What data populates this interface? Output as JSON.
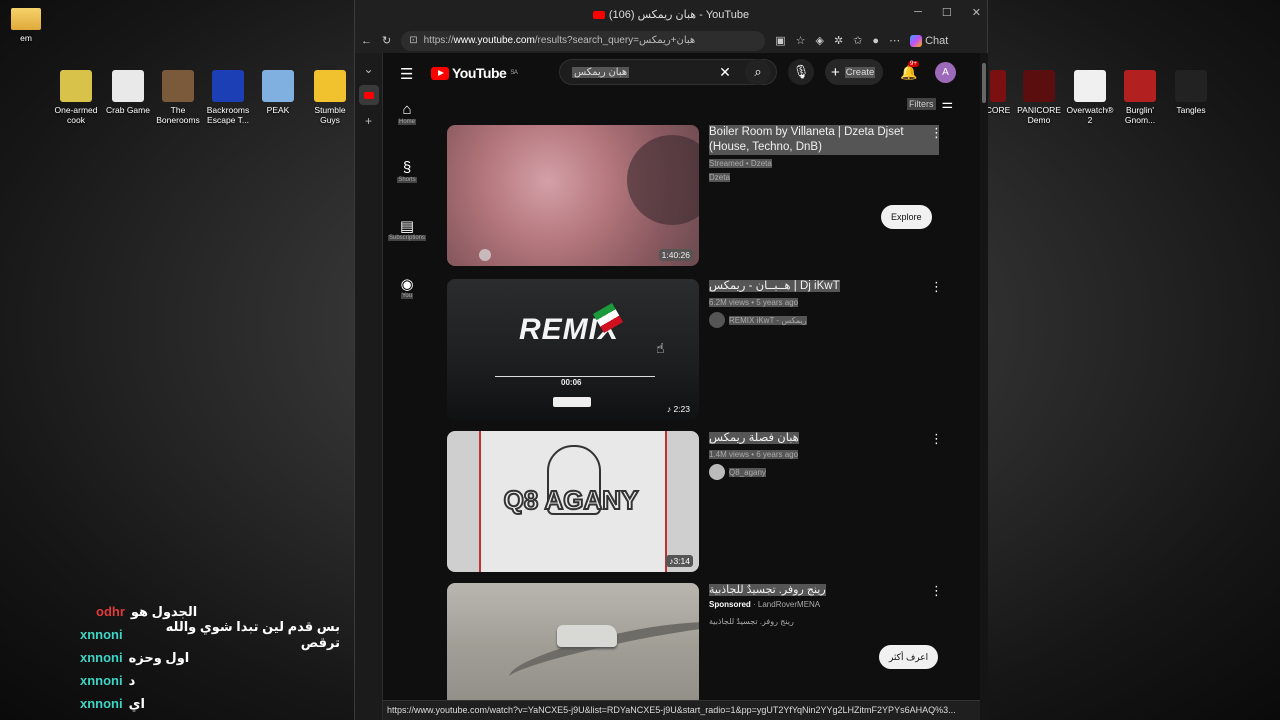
{
  "desktop": {
    "folder_label": "em",
    "icons_left": [
      {
        "label": "One-armed cook",
        "color": "#d9c24a"
      },
      {
        "label": "Crab Game",
        "color": "#e9e9e9"
      },
      {
        "label": "The Bonerooms",
        "color": "#7a5a3a"
      },
      {
        "label": "Backrooms Escape T...",
        "color": "#1d3fb5"
      },
      {
        "label": "PEAK",
        "color": "#7fb0e0"
      },
      {
        "label": "Stumble Guys",
        "color": "#f2c12e"
      }
    ],
    "icons_right": [
      {
        "label": "CORE",
        "color": "#7a1010"
      },
      {
        "label": "PANICORE Demo",
        "color": "#5a0e0e"
      },
      {
        "label": "Overwatch® 2",
        "color": "#f0f0f0"
      },
      {
        "label": "Burglin' Gnom...",
        "color": "#b32020"
      },
      {
        "label": "Tangles",
        "color": "#222222"
      }
    ]
  },
  "chat": [
    {
      "user": "odhr",
      "msg": "الجدول هو",
      "alt": true
    },
    {
      "user": "xnnoni",
      "msg": "بس قدم لين تبدا شوي والله ترقص",
      "alt": false
    },
    {
      "user": "xnnoni",
      "msg": "اول وحزه",
      "alt": false
    },
    {
      "user": "xnnoni",
      "msg": "د",
      "alt": false
    },
    {
      "user": "xnnoni",
      "msg": "اي",
      "alt": false
    }
  ],
  "browser": {
    "tab_title": "(106) هبان ريمكس - YouTube",
    "url_prefix": "https://",
    "url_domain": "www.youtube.com",
    "url_rest": "/results?search_query=هبان+ريمكس",
    "chat_label": "Chat",
    "status_url": "https://www.youtube.com/watch?v=YaNCXE5-j9U&list=RDYaNCXE5-j9U&start_radio=1&pp=ygUT2YfYqNin2YYg2LHZitmF2YPYs6AHAQ%3..."
  },
  "youtube": {
    "logo_text": "YouTube",
    "logo_region": "SA",
    "search_value": "هبان ريمكس",
    "create_label": "Create",
    "notif_count": "9+",
    "avatar_letter": "A",
    "filters_label": "Filters",
    "guide": [
      {
        "icon": "home-icon",
        "glyph": "⌂",
        "label": "Home"
      },
      {
        "icon": "shorts-icon",
        "glyph": "§",
        "label": "Shorts"
      },
      {
        "icon": "subscriptions-icon",
        "glyph": "▤",
        "label": "Subscriptions"
      },
      {
        "icon": "you-icon",
        "glyph": "◉",
        "label": "You"
      }
    ],
    "results": [
      {
        "title": "Boiler Room by Villaneta | Dzeta Djset (House, Techno, DnB)",
        "sub": "Streamed • Dzeta",
        "channel": "Dzeta",
        "duration": "1:40:26",
        "button": "Explore"
      },
      {
        "title": "هــبــان - ريمكس | Dj iKwT",
        "sub": "6.2M views • 5 years ago",
        "channel": "REMIX iKwT - ريمكس",
        "duration": "2:23",
        "thumb_text": "REMIX",
        "thumb_time": "00:06"
      },
      {
        "title": "هبان فصلة ريمكس",
        "sub": "1.4M views • 6 years ago",
        "channel": "Q8_agany",
        "duration": "3:14",
        "thumb_text": "Q8 AGANY"
      },
      {
        "title": "رينج روفر. تجسيدٌ للجاذبية",
        "sponsored": "Sponsored",
        "advertiser": "LandRoverMENA",
        "desc": "رينج روفر. تجسيدٌ للجاذبية",
        "button": "اعرف أكثر"
      }
    ]
  }
}
